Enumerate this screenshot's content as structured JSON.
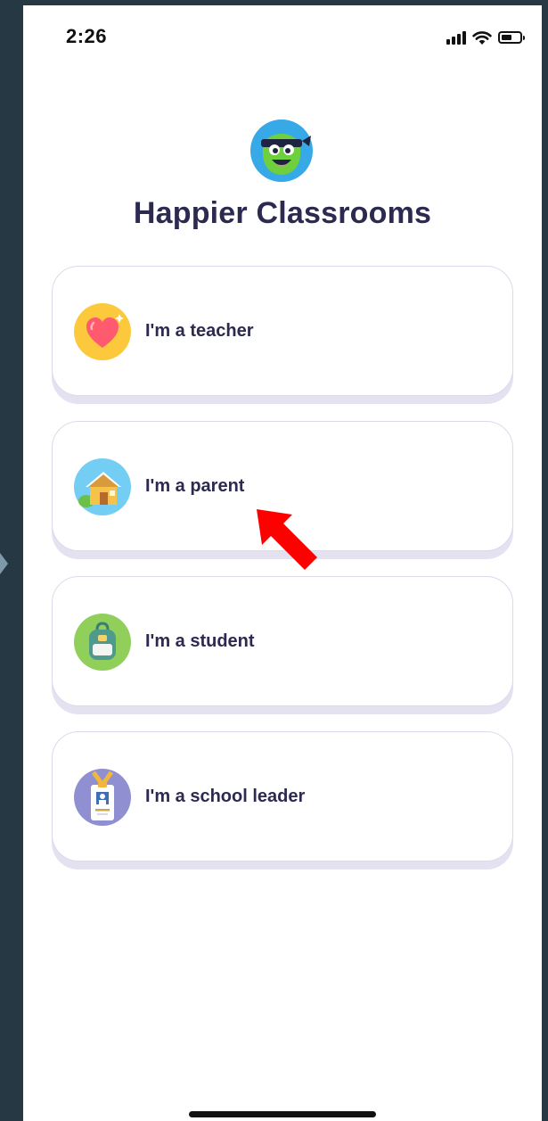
{
  "status_bar": {
    "time": "2:26"
  },
  "app": {
    "title": "Happier Classrooms",
    "logo_icon": "classdojo-monster-icon"
  },
  "roles": [
    {
      "label": "I'm a teacher",
      "icon": "heart-icon",
      "icon_bg": "#fcc93c"
    },
    {
      "label": "I'm a parent",
      "icon": "house-icon",
      "icon_bg": "#74cdf2"
    },
    {
      "label": "I'm a student",
      "icon": "backpack-icon",
      "icon_bg": "#8fcf5a"
    },
    {
      "label": "I'm a school leader",
      "icon": "id-badge-icon",
      "icon_bg": "#8f8fd1"
    }
  ],
  "colors": {
    "title_text": "#2c2a50",
    "card_border": "#dcdaea",
    "annotation_arrow": "#ff0000",
    "outer_background": "#263843"
  }
}
